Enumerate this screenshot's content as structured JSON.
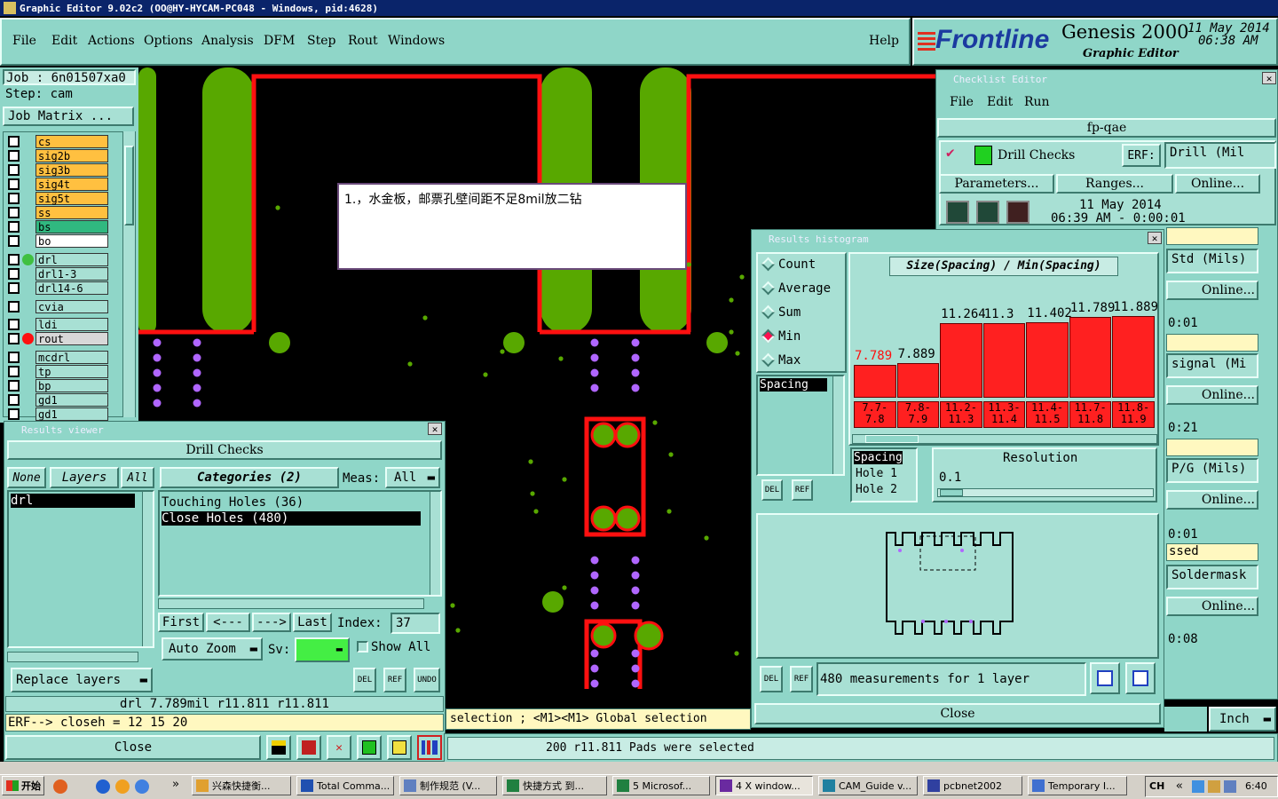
{
  "window_title": "Graphic Editor 9.02c2 (OO@HY-HYCAM-PC048 - Windows, pid:4628)",
  "menu": [
    "File",
    "Edit",
    "Actions",
    "Options",
    "Analysis",
    "DFM",
    "Step",
    "Rout",
    "Windows"
  ],
  "help": "Help",
  "brand": {
    "logo": "Frontline",
    "product": "Genesis 2000",
    "subtitle": "Graphic Editor",
    "date": "11 May 2014",
    "time": "06:38 AM"
  },
  "job": {
    "job_label": "Job : 6n01507xa0",
    "step_label": "Step: cam",
    "matrix_btn": "Job Matrix ..."
  },
  "layers": [
    "cs",
    "sig2b",
    "sig3b",
    "sig4t",
    "sig5t",
    "ss",
    "bs",
    "bo",
    "drl",
    "drl1-3",
    "drl14-6",
    "cvia",
    "ldi",
    "rout",
    "mcdrl",
    "tp",
    "bp",
    "gd1",
    "gd1"
  ],
  "note": "1.，水金板，邮票孔壁间距不足8mil放二钻",
  "checklist": {
    "title": "Checklist Editor",
    "menu": [
      "File",
      "Edit",
      "Run"
    ],
    "name": "fp-qae",
    "drill_checks": "Drill Checks",
    "erf": "ERF:",
    "erf_value": "Drill (Mil",
    "params_btn": "Parameters...",
    "ranges_btn": "Ranges...",
    "online_btn": "Online...",
    "run_date": "11 May 2014",
    "run_time": "06:39 AM - 0:00:01",
    "rows": [
      "Std (Mils)",
      "signal (Mi",
      "P/G (Mils)",
      "Soldermask"
    ],
    "times": [
      "0:01",
      "0:21",
      "0:01",
      "0:08"
    ],
    "passed": "ssed",
    "inch": "Inch"
  },
  "histogram": {
    "title": "Results histogram",
    "options": [
      "Count",
      "Average",
      "Sum",
      "Min",
      "Max"
    ],
    "selected": "Min",
    "heading": "Size(Spacing) / Min(Spacing)",
    "list_item": "Spacing",
    "info_rows": [
      "Spacing",
      "Hole 1",
      "Hole 2"
    ],
    "resolution_label": "Resolution",
    "resolution_value": "0.1",
    "measurements": "480 measurements for 1 layer",
    "close": "Close",
    "del": "DEL",
    "ref": "REF"
  },
  "chart_data": {
    "type": "bar",
    "title": "Size(Spacing) / Min(Spacing)",
    "categories": [
      "7.7-7.8",
      "7.8-7.9",
      "11.2-11.3",
      "11.3-11.4",
      "11.4-11.5",
      "11.7-11.8",
      "11.8-11.9"
    ],
    "cat_top": [
      "7.7-",
      "7.8-",
      "11.2-",
      "11.3-",
      "11.4-",
      "11.7-",
      "11.8-"
    ],
    "cat_bottom": [
      "7.8",
      "7.9",
      "11.3",
      "11.4",
      "11.5",
      "11.8",
      "11.9"
    ],
    "values": [
      7.789,
      7.889,
      11.264,
      11.3,
      11.402,
      11.789,
      11.889
    ],
    "labels": [
      "7.789",
      "7.889",
      "11.264",
      "11.3",
      "11.402",
      "11.789",
      "11.889"
    ],
    "ylim": [
      0,
      14
    ]
  },
  "results": {
    "title": "Results viewer",
    "heading": "Drill Checks",
    "none": "None",
    "layers": "Layers",
    "all": "All",
    "categories": "Categories (2)",
    "meas_label": "Meas:",
    "meas_value": "All",
    "layer_item": "drl",
    "cat_items": [
      "Touching Holes (36)",
      "Close Holes (480)"
    ],
    "first": "First",
    "prev": "<---",
    "next": "--->",
    "last": "Last",
    "index_label": "Index:",
    "index_value": "37",
    "auto_zoom": "Auto Zoom",
    "sv_label": "Sv:",
    "show_all": "Show All",
    "replace_layers": "Replace layers",
    "del": "DEL",
    "ref": "REF",
    "undo": "UNDO",
    "measure_line": "drl 7.789mil   r11.811   r11.811",
    "erf_line": "ERF--> closeh = 12 15 20",
    "close": "Close"
  },
  "status": {
    "selection": "selection ; <M1><M1> Global selection",
    "pads": "200 r11.811 Pads were selected"
  },
  "taskbar": {
    "start": "开始",
    "items": [
      "兴森快捷衡...",
      "Total Comma...",
      "制作规范 (V...",
      "快捷方式 到...",
      "5 Microsof...",
      "4 X window...",
      "CAM_Guide v...",
      "pcbnet2002",
      "Temporary I..."
    ],
    "lang": "CH",
    "clock": "6:40"
  }
}
